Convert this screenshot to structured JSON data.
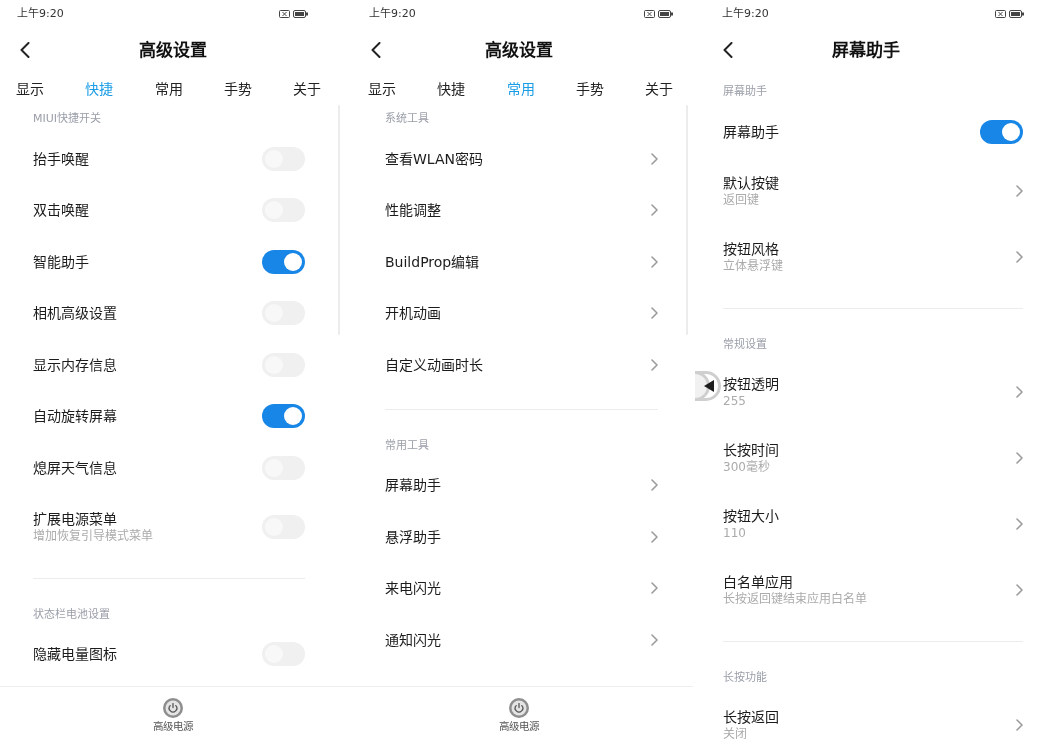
{
  "screens": [
    {
      "status_bar": {
        "time": "上午9:20"
      },
      "header": {
        "title": "高级设置"
      },
      "tabs": [
        {
          "label": "显示",
          "selected": false
        },
        {
          "label": "快捷",
          "selected": true
        },
        {
          "label": "常用",
          "selected": false
        },
        {
          "label": "手势",
          "selected": false
        },
        {
          "label": "关于",
          "selected": false
        }
      ],
      "scroll_indicator": true,
      "sections": [
        {
          "title": "MIUI快捷开关",
          "items": [
            {
              "kind": "toggle",
              "label": "抬手唤醒",
              "on": false
            },
            {
              "kind": "toggle",
              "label": "双击唤醒",
              "on": false
            },
            {
              "kind": "toggle",
              "label": "智能助手",
              "on": true
            },
            {
              "kind": "toggle",
              "label": "相机高级设置",
              "on": false
            },
            {
              "kind": "toggle",
              "label": "显示内存信息",
              "on": false
            },
            {
              "kind": "toggle",
              "label": "自动旋转屏幕",
              "on": true
            },
            {
              "kind": "toggle",
              "label": "熄屏天气信息",
              "on": false
            },
            {
              "kind": "toggle",
              "label": "扩展电源菜单",
              "subtitle": "增加恢复引导模式菜单",
              "on": false
            }
          ]
        },
        {
          "title": "状态栏电池设置",
          "items": [
            {
              "kind": "toggle",
              "label": "隐藏电量图标",
              "on": false
            }
          ]
        }
      ],
      "bottom_bar": {
        "label": "高级电源"
      }
    },
    {
      "status_bar": {
        "time": "上午9:20"
      },
      "header": {
        "title": "高级设置"
      },
      "tabs": [
        {
          "label": "显示",
          "selected": false
        },
        {
          "label": "快捷",
          "selected": false
        },
        {
          "label": "常用",
          "selected": true
        },
        {
          "label": "手势",
          "selected": false
        },
        {
          "label": "关于",
          "selected": false
        }
      ],
      "scroll_indicator": true,
      "sections": [
        {
          "title": "系统工具",
          "items": [
            {
              "kind": "link",
              "label": "查看WLAN密码"
            },
            {
              "kind": "link",
              "label": "性能调整"
            },
            {
              "kind": "link",
              "label": "BuildProp编辑"
            },
            {
              "kind": "link",
              "label": "开机动画"
            },
            {
              "kind": "link",
              "label": "自定义动画时长"
            }
          ]
        },
        {
          "title": "常用工具",
          "items": [
            {
              "kind": "link",
              "label": "屏幕助手"
            },
            {
              "kind": "link",
              "label": "悬浮助手"
            },
            {
              "kind": "link",
              "label": "来电闪光"
            },
            {
              "kind": "link",
              "label": "通知闪光"
            }
          ]
        }
      ],
      "bottom_bar": {
        "label": "高级电源"
      }
    },
    {
      "status_bar": {
        "time": "上午9:20"
      },
      "header": {
        "title": "屏幕助手"
      },
      "floating_button": true,
      "sections": [
        {
          "title": "屏幕助手",
          "items": [
            {
              "kind": "toggle",
              "label": "屏幕助手",
              "on": true
            },
            {
              "kind": "link",
              "label": "默认按键",
              "subtitle": "返回键"
            },
            {
              "kind": "link",
              "label": "按钮风格",
              "subtitle": "立体悬浮键"
            }
          ]
        },
        {
          "title": "常规设置",
          "items": [
            {
              "kind": "link",
              "label": "按钮透明",
              "subtitle": "255"
            },
            {
              "kind": "link",
              "label": "长按时间",
              "subtitle": "300毫秒"
            },
            {
              "kind": "link",
              "label": "按钮大小",
              "subtitle": "110"
            },
            {
              "kind": "link",
              "label": "白名单应用",
              "subtitle": "长按返回键结束应用白名单"
            }
          ]
        },
        {
          "title": "长按功能",
          "items": [
            {
              "kind": "link",
              "label": "长按返回",
              "subtitle": "关闭"
            }
          ]
        }
      ]
    }
  ]
}
